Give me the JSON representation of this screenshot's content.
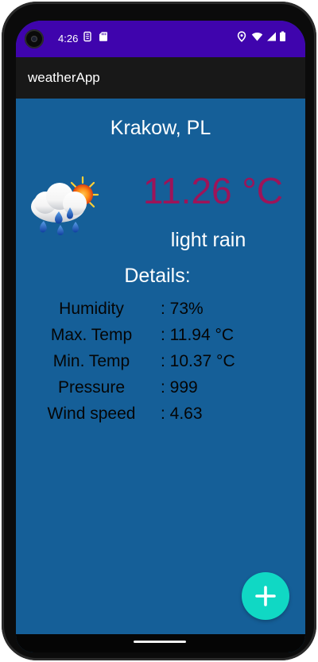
{
  "status_bar": {
    "time": "4:26",
    "left_icons": [
      "notification-icon",
      "sd-card-icon"
    ],
    "right_icons": [
      "location-icon",
      "wifi-icon",
      "signal-icon",
      "battery-icon"
    ]
  },
  "app_bar": {
    "title": "weatherApp"
  },
  "weather": {
    "city": "Krakow, PL",
    "icon": "rain-cloud-sun-icon",
    "temperature": "11.26 °C",
    "description": "light rain"
  },
  "details": {
    "title": "Details:",
    "rows": [
      {
        "label": "Humidity",
        "value": ": 73%"
      },
      {
        "label": "Max. Temp",
        "value": ": 11.94 °C"
      },
      {
        "label": "Min. Temp",
        "value": ": 10.37 °C"
      },
      {
        "label": "Pressure",
        "value": ": 999"
      },
      {
        "label": "Wind speed",
        "value": ": 4.63"
      }
    ]
  },
  "fab": {
    "icon": "plus-icon",
    "symbol": "+"
  },
  "colors": {
    "status_bar": "#3f04ad",
    "app_bar": "#181818",
    "background": "#155f98",
    "temperature": "#9d1459",
    "details_text": "#050505",
    "fab": "#10d8c4"
  }
}
